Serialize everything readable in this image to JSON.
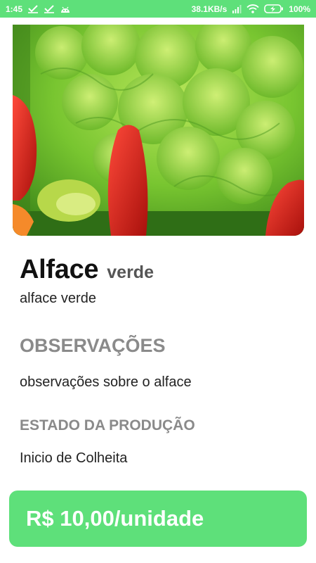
{
  "status_bar": {
    "time": "1:45",
    "network_speed": "38.1KB/s",
    "battery": "100%",
    "icons": [
      "check-icon",
      "check-icon",
      "android-icon",
      "signal-icon",
      "wifi-icon",
      "battery-charging-icon"
    ]
  },
  "product": {
    "image_subject": "lettuce-with-peppers",
    "name": "Alface",
    "variety": "verde",
    "description": "alface verde"
  },
  "observations": {
    "heading": "OBSERVAÇÕES",
    "text": "observações sobre o alface"
  },
  "production_state": {
    "heading": "ESTADO DA PRODUÇÃO",
    "text": "Inicio de Colheita"
  },
  "price": {
    "label": "R$ 10,00/unidade"
  },
  "colors": {
    "accent": "#5ee07a",
    "heading_gray": "#8a8a8a",
    "text_dark": "#111111"
  }
}
